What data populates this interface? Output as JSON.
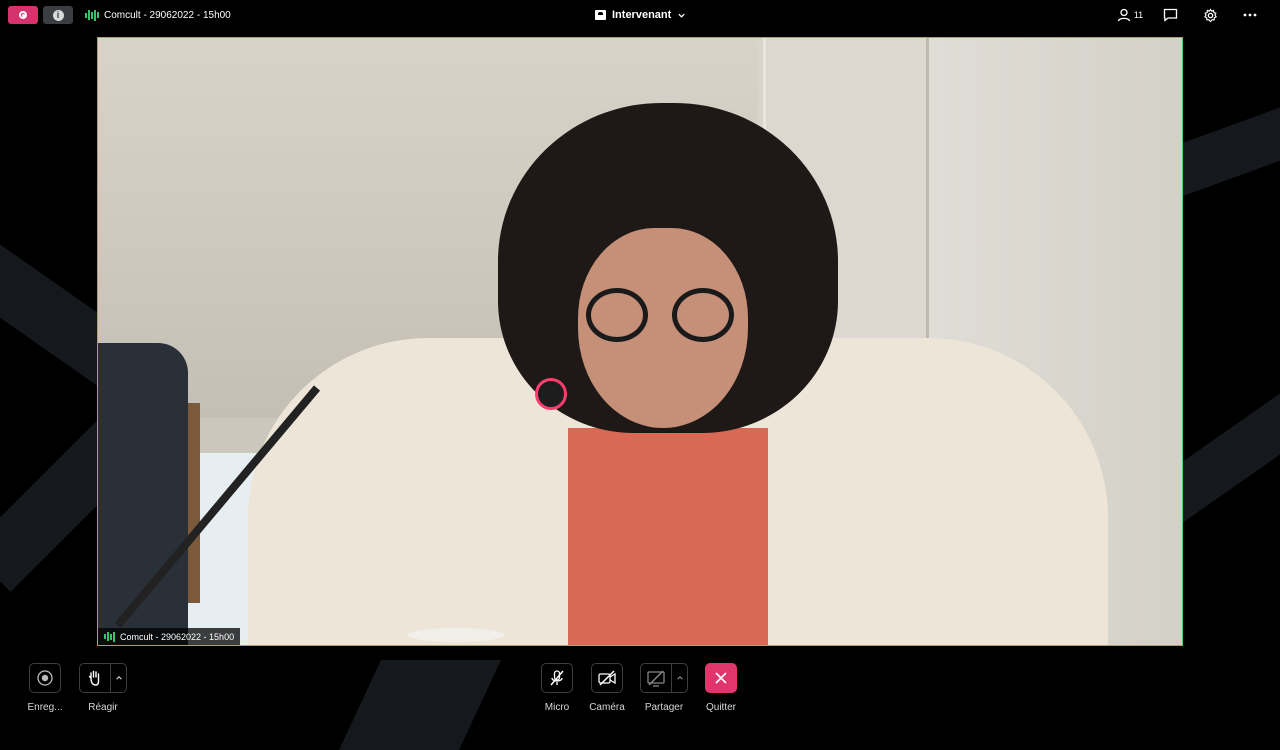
{
  "topbar": {
    "meeting_title": "Comcult - 29062022 - 15h00",
    "layout_label": "Intervenant",
    "participant_count": "11",
    "icons": [
      "record-icon",
      "info-icon",
      "audio-bars-icon",
      "layout-icon",
      "chevron-down-icon",
      "participants-icon",
      "chat-icon",
      "settings-icon",
      "more-icon"
    ]
  },
  "video": {
    "label": "Comcult - 29062022 - 15h00",
    "border_color": "#4fd06a"
  },
  "toolbar": {
    "record_label": "Enreg...",
    "react_label": "Réagir",
    "micro_label": "Micro",
    "camera_label": "Caméra",
    "share_label": "Partager",
    "quit_label": "Quitter"
  },
  "colors": {
    "accent": "#e0356d",
    "audio": "#36c46b",
    "background": "#000000"
  }
}
